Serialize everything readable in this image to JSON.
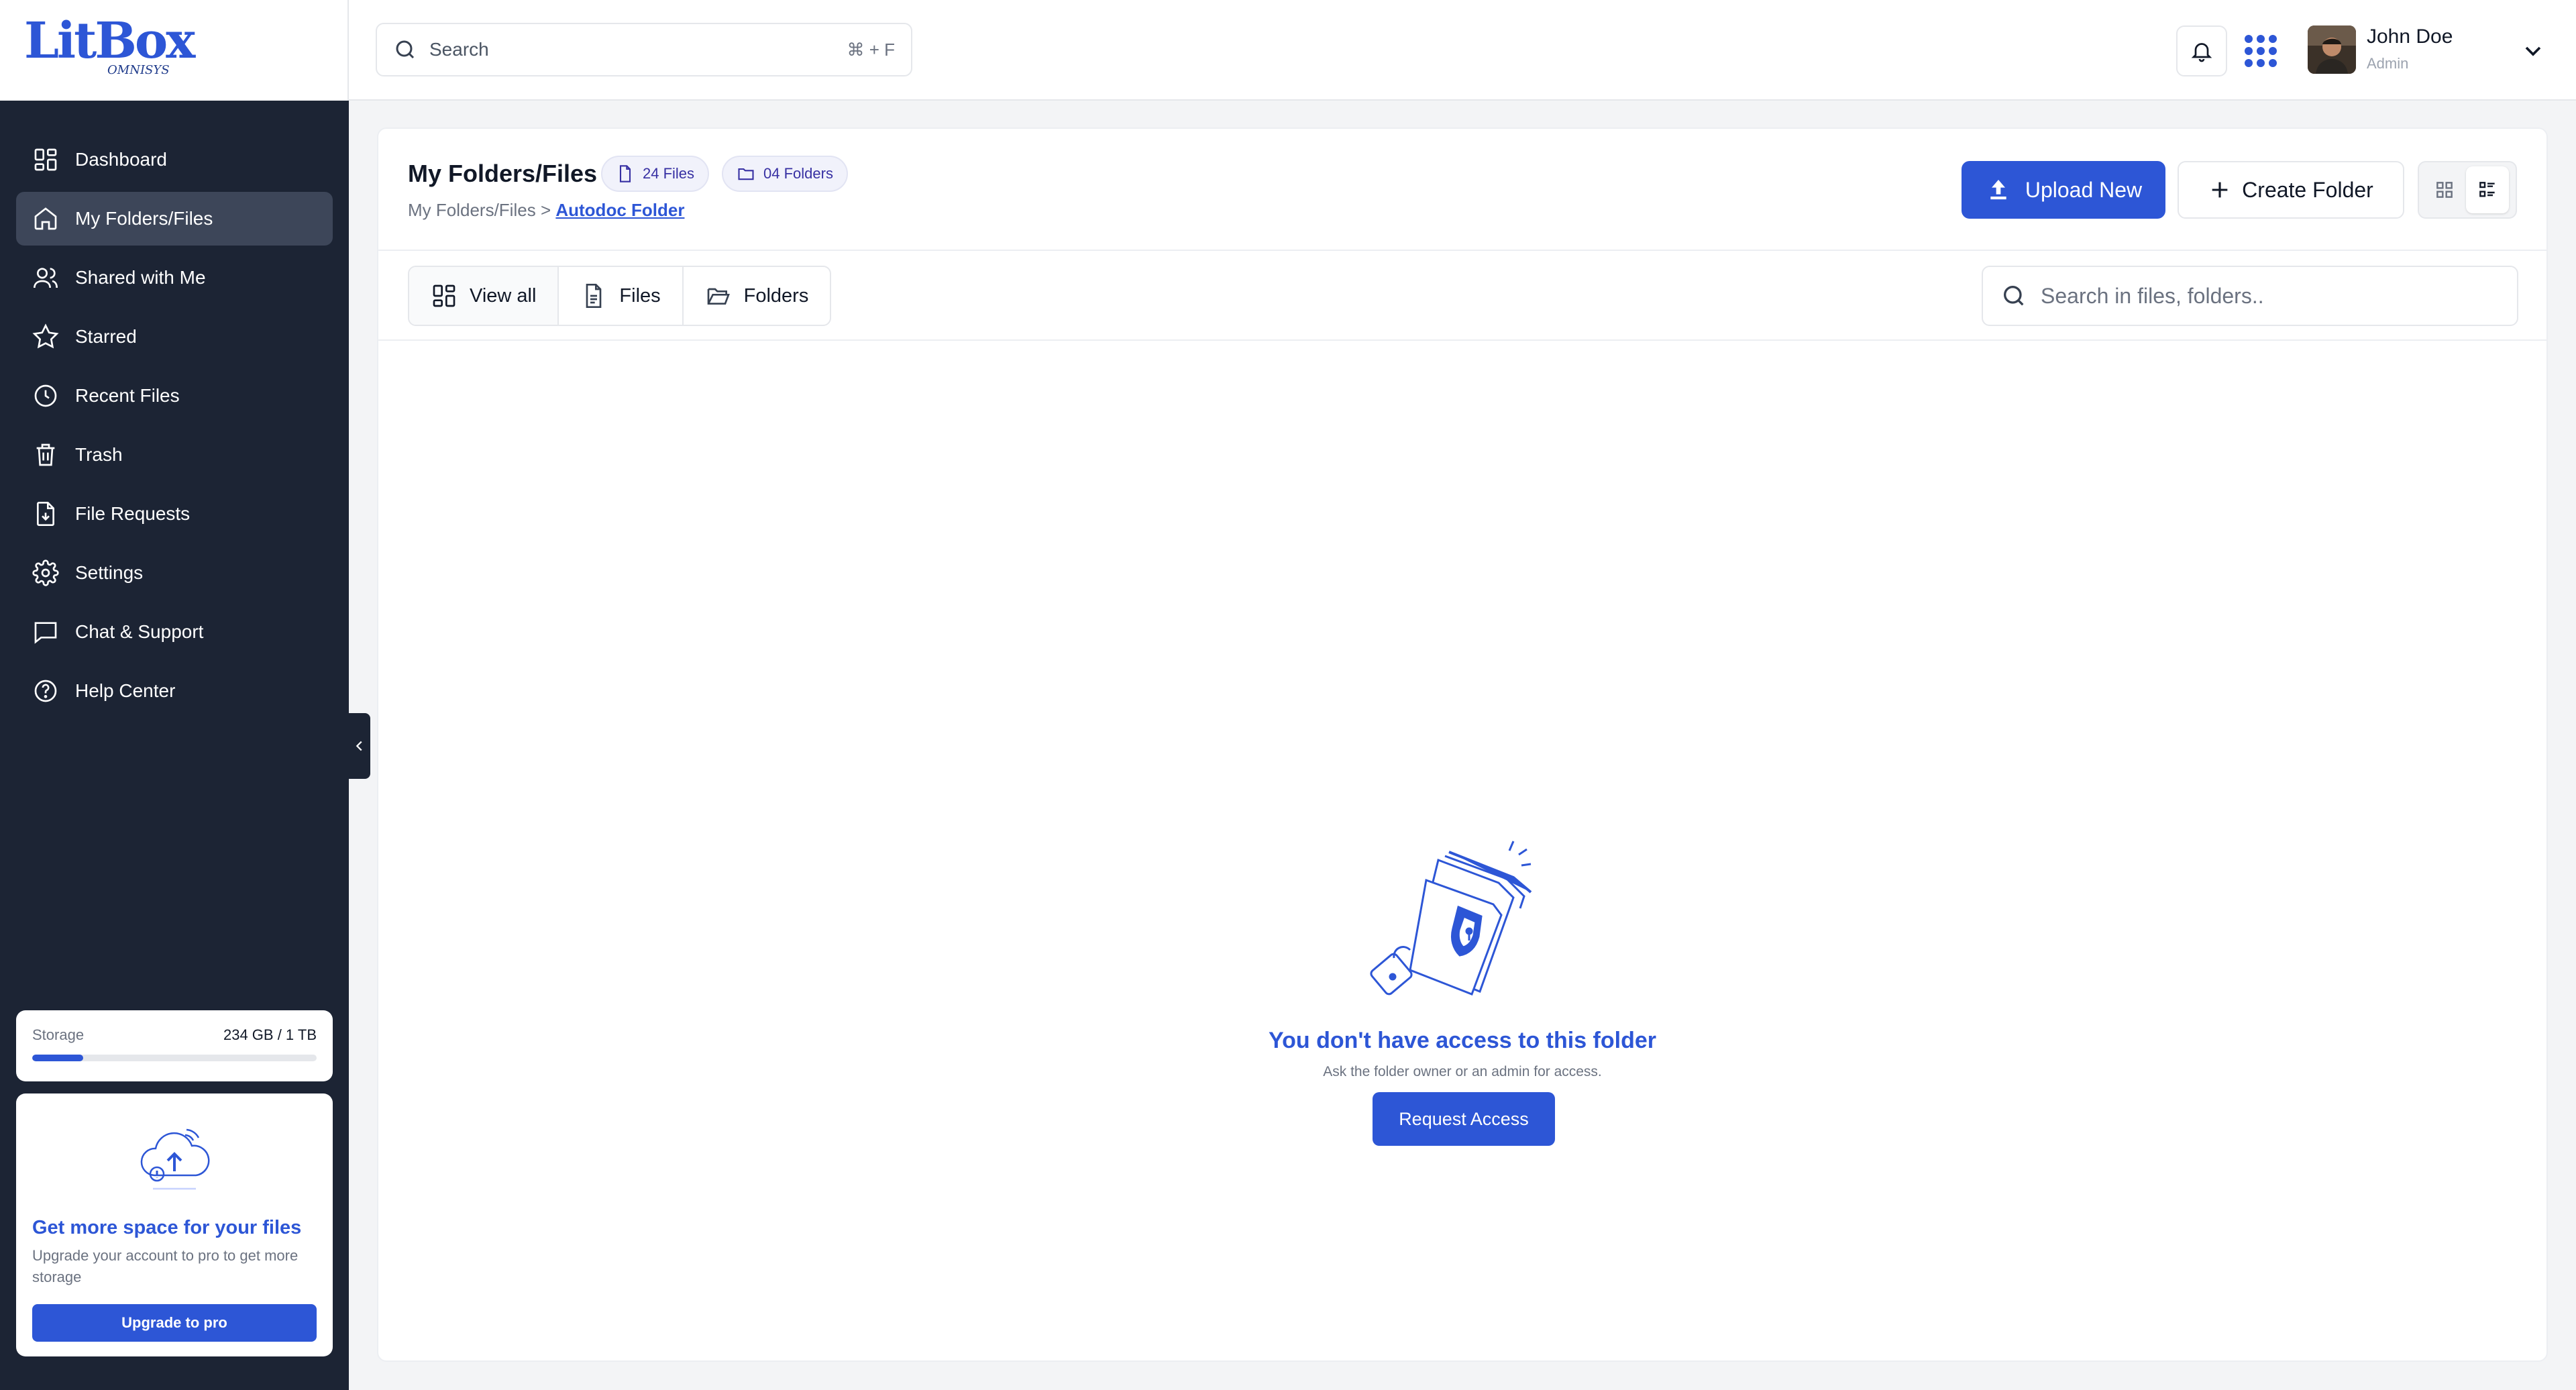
{
  "brand": {
    "name": "LitBox",
    "sub": "OMNISYS"
  },
  "colors": {
    "accent": "#2d56d6",
    "sidebar": "#1c2434",
    "sidebar_active": "#3d4659"
  },
  "topbar": {
    "search_placeholder": "Search",
    "search_shortcut": "⌘ + F",
    "user": {
      "name": "John Doe",
      "role": "Admin"
    }
  },
  "sidebar": {
    "items": [
      {
        "label": "Dashboard",
        "icon": "grid-icon"
      },
      {
        "label": "My Folders/Files",
        "icon": "home-icon",
        "active": true
      },
      {
        "label": "Shared with Me",
        "icon": "users-icon"
      },
      {
        "label": "Starred",
        "icon": "star-icon"
      },
      {
        "label": "Recent Files",
        "icon": "clock-icon"
      },
      {
        "label": "Trash",
        "icon": "trash-icon"
      },
      {
        "label": "File Requests",
        "icon": "file-request-icon"
      },
      {
        "label": "Settings",
        "icon": "gear-icon"
      },
      {
        "label": "Chat & Support",
        "icon": "chat-icon"
      },
      {
        "label": "Help Center",
        "icon": "help-icon"
      }
    ],
    "storage": {
      "label": "Storage",
      "value": "234 GB / 1 TB",
      "fraction": 0.18
    },
    "upgrade": {
      "title": "Get more space for your files",
      "description": "Upgrade your account to pro to get more storage",
      "button": "Upgrade to pro"
    }
  },
  "main": {
    "title": "My Folders/Files",
    "files_count": "24 Files",
    "folders_count": "04 Folders",
    "breadcrumb_root": "My Folders/Files",
    "breadcrumb_sep": ">",
    "breadcrumb_current": "Autodoc Folder",
    "upload_label": "Upload New",
    "create_folder_label": "Create Folder",
    "filters": [
      {
        "label": "View all",
        "active": true
      },
      {
        "label": "Files",
        "active": false
      },
      {
        "label": "Folders",
        "active": false
      }
    ],
    "search_placeholder": "Search in files, folders..",
    "empty_state": {
      "title": "You don't have access to this folder",
      "subtitle": "Ask the folder owner or an admin for access.",
      "button": "Request Access"
    }
  }
}
